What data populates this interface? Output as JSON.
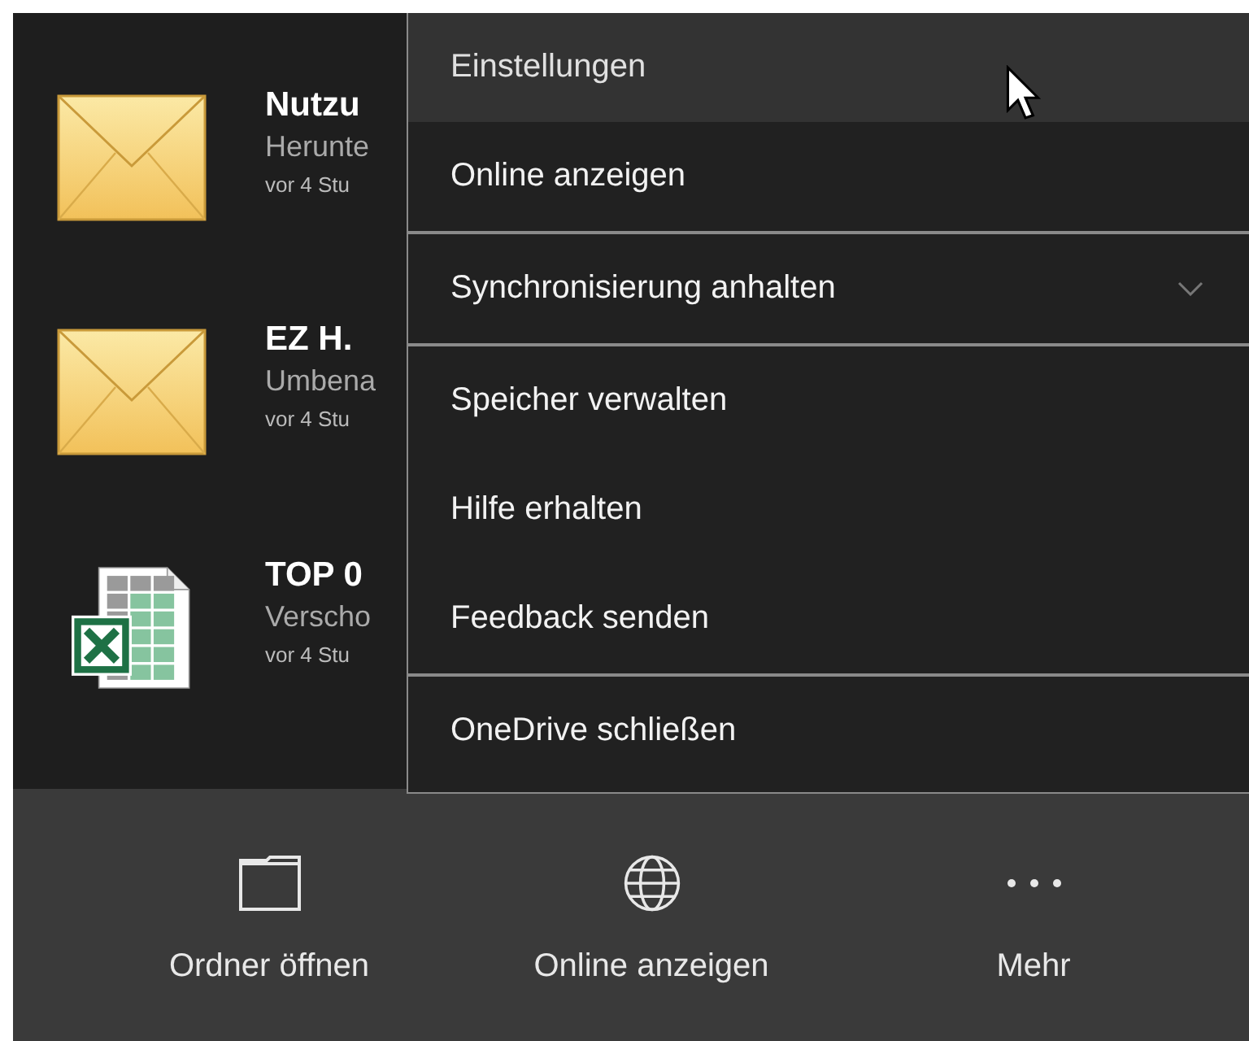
{
  "files": [
    {
      "kind": "mail",
      "title": "Nutzu",
      "detail": "Herunte",
      "time": "vor 4 Stu"
    },
    {
      "kind": "mail",
      "title": "EZ H.",
      "detail": "Umbena",
      "time": "vor 4 Stu"
    },
    {
      "kind": "spreadsheet",
      "title": "TOP 0",
      "detail": "Verscho",
      "time": "vor 4 Stu"
    }
  ],
  "menu": {
    "sections": [
      [
        {
          "label": "Einstellungen",
          "highlighted": true,
          "kind": "item"
        },
        {
          "label": "Online anzeigen",
          "highlighted": false,
          "kind": "item"
        }
      ],
      [
        {
          "label": "Synchronisierung anhalten",
          "highlighted": false,
          "kind": "submenu"
        }
      ],
      [
        {
          "label": "Speicher verwalten",
          "highlighted": false,
          "kind": "item"
        },
        {
          "label": "Hilfe erhalten",
          "highlighted": false,
          "kind": "item"
        },
        {
          "label": "Feedback senden",
          "highlighted": false,
          "kind": "item"
        }
      ],
      [
        {
          "label": "OneDrive schließen",
          "highlighted": false,
          "kind": "item"
        }
      ]
    ]
  },
  "footer": [
    {
      "kind": "folder",
      "label": "Ordner öffnen"
    },
    {
      "kind": "globe",
      "label": "Online anzeigen"
    },
    {
      "kind": "more",
      "label": "Mehr"
    }
  ]
}
